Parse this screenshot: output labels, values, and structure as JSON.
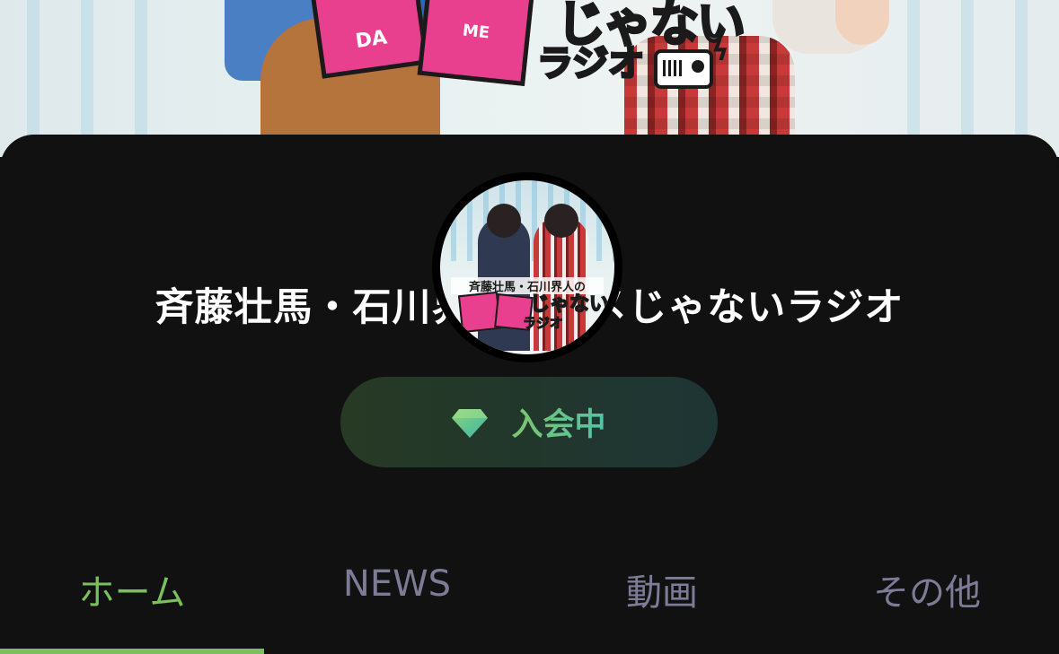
{
  "channel": {
    "title": "斉藤壮馬・石川界人のダメじゃないラジオ",
    "banner_logo": {
      "da": "DA",
      "me": "ME",
      "janai": "じゃない",
      "radio": "ラジオ"
    },
    "avatar_logo": {
      "names": "斉藤壮馬・石川界人の",
      "janai": "じゃない",
      "radio": "ラジオ"
    }
  },
  "membership": {
    "label": "入会中",
    "icon": "diamond-icon"
  },
  "tabs": [
    {
      "label": "ホーム",
      "active": true
    },
    {
      "label": "NEWS",
      "active": false
    },
    {
      "label": "動画",
      "active": false
    },
    {
      "label": "その他",
      "active": false
    }
  ],
  "colors": {
    "background": "#111111",
    "accent_green": "#79c05f",
    "accent_teal": "#4fc3a8",
    "tab_inactive": "#7d7b96",
    "logo_pink": "#e83f8e",
    "logo_blue": "#3b7fd6"
  }
}
